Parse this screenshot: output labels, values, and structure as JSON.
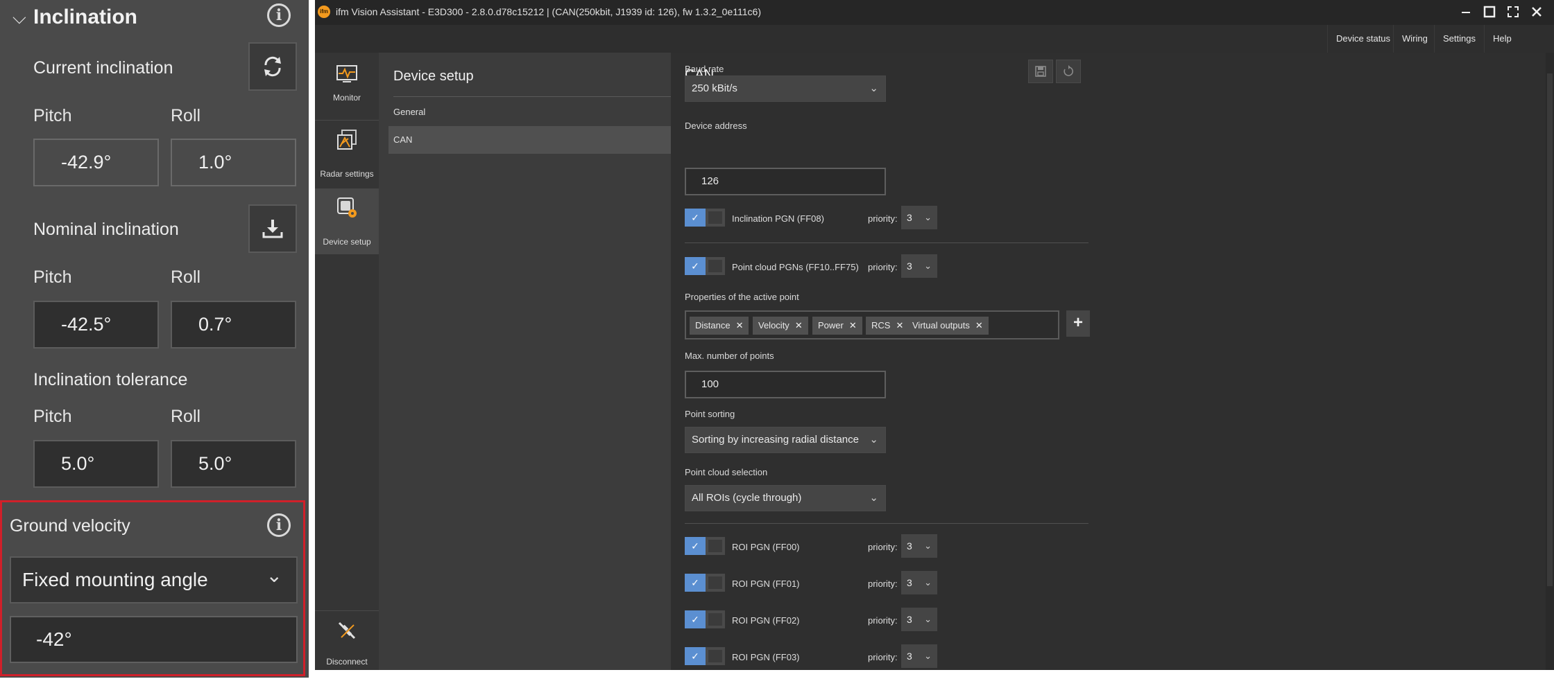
{
  "left_panel": {
    "title": "Inclination",
    "current": {
      "label": "Current inclination",
      "pitch_label": "Pitch",
      "roll_label": "Roll",
      "pitch": "-42.9°",
      "roll": "1.0°"
    },
    "nominal": {
      "label": "Nominal inclination",
      "pitch_label": "Pitch",
      "roll_label": "Roll",
      "pitch": "-42.5°",
      "roll": "0.7°"
    },
    "tolerance": {
      "label": "Inclination tolerance",
      "pitch_label": "Pitch",
      "roll_label": "Roll",
      "pitch": "5.0°",
      "roll": "5.0°"
    },
    "ground_velocity": {
      "label": "Ground velocity",
      "mode": "Fixed mounting angle",
      "angle": "-42°"
    }
  },
  "window": {
    "title": "ifm Vision Assistant - E3D300 - 2.8.0.d78c15212 |  (CAN(250kbit, J1939 id: 126), fw 1.3.2_0e111c6)",
    "logo_text": "ifm",
    "menu": [
      "Device status",
      "Wiring",
      "Settings",
      "Help"
    ]
  },
  "nav": {
    "monitor": "Monitor",
    "radar_settings": "Radar settings",
    "device_setup": "Device setup",
    "disconnect": "Disconnect"
  },
  "settings_list": {
    "title": "Device setup",
    "items": [
      "General",
      "CAN"
    ]
  },
  "can": {
    "title": "CAN",
    "baud_rate_label": "Baud rate",
    "baud_rate": "250 kBit/s",
    "device_address_label": "Device address",
    "device_address": "126",
    "priority_label": "priority:",
    "inclination_pgn": {
      "label": "Inclination PGN (FF08)",
      "enabled": true,
      "priority": "3"
    },
    "point_cloud_pgn": {
      "label": "Point cloud PGNs (FF10..FF75)",
      "enabled": true,
      "priority": "3"
    },
    "active_point_label": "Properties of the active point",
    "active_point_props": [
      "Distance",
      "Velocity",
      "Power",
      "RCS",
      "Virtual outputs"
    ],
    "chip_remove": "✕",
    "add_symbol": "+",
    "max_points_label": "Max. number of points",
    "max_points": "100",
    "point_sorting_label": "Point sorting",
    "point_sorting": "Sorting by increasing radial distance",
    "point_cloud_selection_label": "Point cloud selection",
    "point_cloud_selection": "All ROIs (cycle through)",
    "roi_pgns": [
      {
        "label": "ROI PGN (FF00)",
        "enabled": true,
        "priority": "3"
      },
      {
        "label": "ROI PGN (FF01)",
        "enabled": true,
        "priority": "3"
      },
      {
        "label": "ROI PGN (FF02)",
        "enabled": true,
        "priority": "3"
      },
      {
        "label": "ROI PGN (FF03)",
        "enabled": true,
        "priority": "3"
      }
    ]
  },
  "icons": {
    "chevron": "⌄",
    "check": "✓",
    "info": "i"
  },
  "colors": {
    "toggle_on": "#5b8fd1",
    "highlight": "#d0202a",
    "logo": "#f39a1e"
  }
}
